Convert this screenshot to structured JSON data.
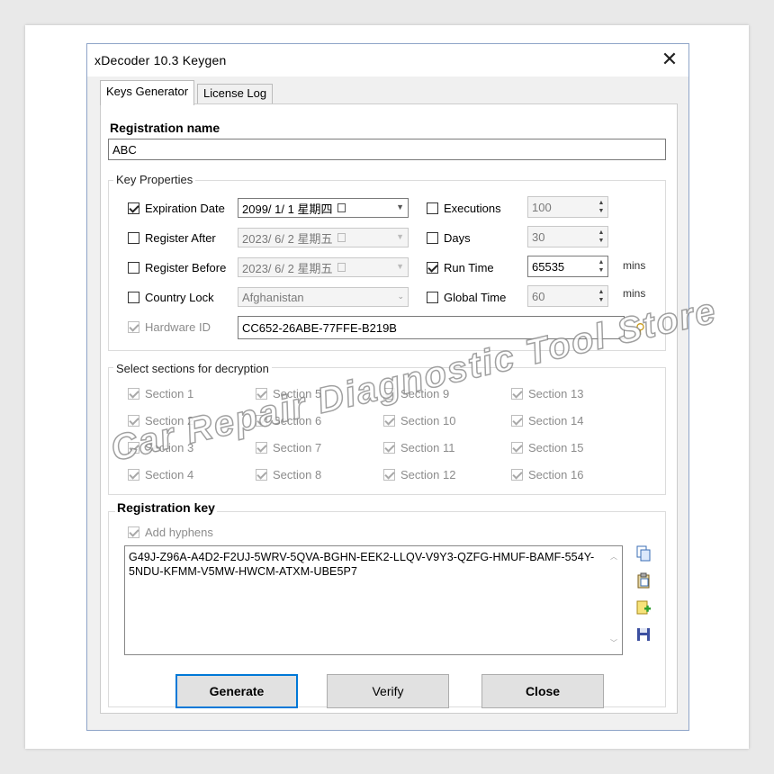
{
  "window": {
    "title": "xDecoder 10.3 Keygen",
    "close": "✕"
  },
  "tabs": [
    {
      "label": "Keys Generator"
    },
    {
      "label": "License Log"
    }
  ],
  "registration_name": {
    "label": "Registration name",
    "value": "ABC"
  },
  "key_properties": {
    "title": "Key Properties",
    "expiration_date": {
      "label": "Expiration Date",
      "checked": true,
      "value": "2099/ 1/ 1 星期四"
    },
    "register_after": {
      "label": "Register After",
      "checked": false,
      "value": "2023/ 6/ 2 星期五"
    },
    "register_before": {
      "label": "Register Before",
      "checked": false,
      "value": "2023/ 6/ 2 星期五"
    },
    "country_lock": {
      "label": "Country Lock",
      "checked": false,
      "value": "Afghanistan"
    },
    "hardware_id": {
      "label": "Hardware ID",
      "checked": true,
      "value": "CC652-26ABE-77FFE-B219B"
    },
    "executions": {
      "label": "Executions",
      "checked": false,
      "value": "100"
    },
    "days": {
      "label": "Days",
      "checked": false,
      "value": "30"
    },
    "run_time": {
      "label": "Run Time",
      "checked": true,
      "value": "65535",
      "unit": "mins"
    },
    "global_time": {
      "label": "Global Time",
      "checked": false,
      "value": "60",
      "unit": "mins"
    }
  },
  "sections": {
    "title": "Select sections for decryption",
    "items": [
      "Section 1",
      "Section 2",
      "Section 3",
      "Section 4",
      "Section 5",
      "Section 6",
      "Section 7",
      "Section 8",
      "Section 9",
      "Section 10",
      "Section 11",
      "Section 12",
      "Section 13",
      "Section 14",
      "Section 15",
      "Section 16"
    ]
  },
  "registration_key": {
    "label": "Registration key",
    "add_hyphens": "Add hyphens",
    "value": "G49J-Z96A-A4D2-F2UJ-5WRV-5QVA-BGHN-EEK2-LLQV-V9Y3-QZFG-HMUF-BAMF-554Y-5NDU-KFMM-V5MW-HWCM-ATXM-UBE5P7"
  },
  "buttons": {
    "generate": "Generate",
    "verify": "Verify",
    "close": "Close"
  },
  "watermark": "Car Repair Diagnostic Tool Store",
  "colors": {
    "accent": "#0078d7",
    "window_border": "#8ea4c8"
  }
}
